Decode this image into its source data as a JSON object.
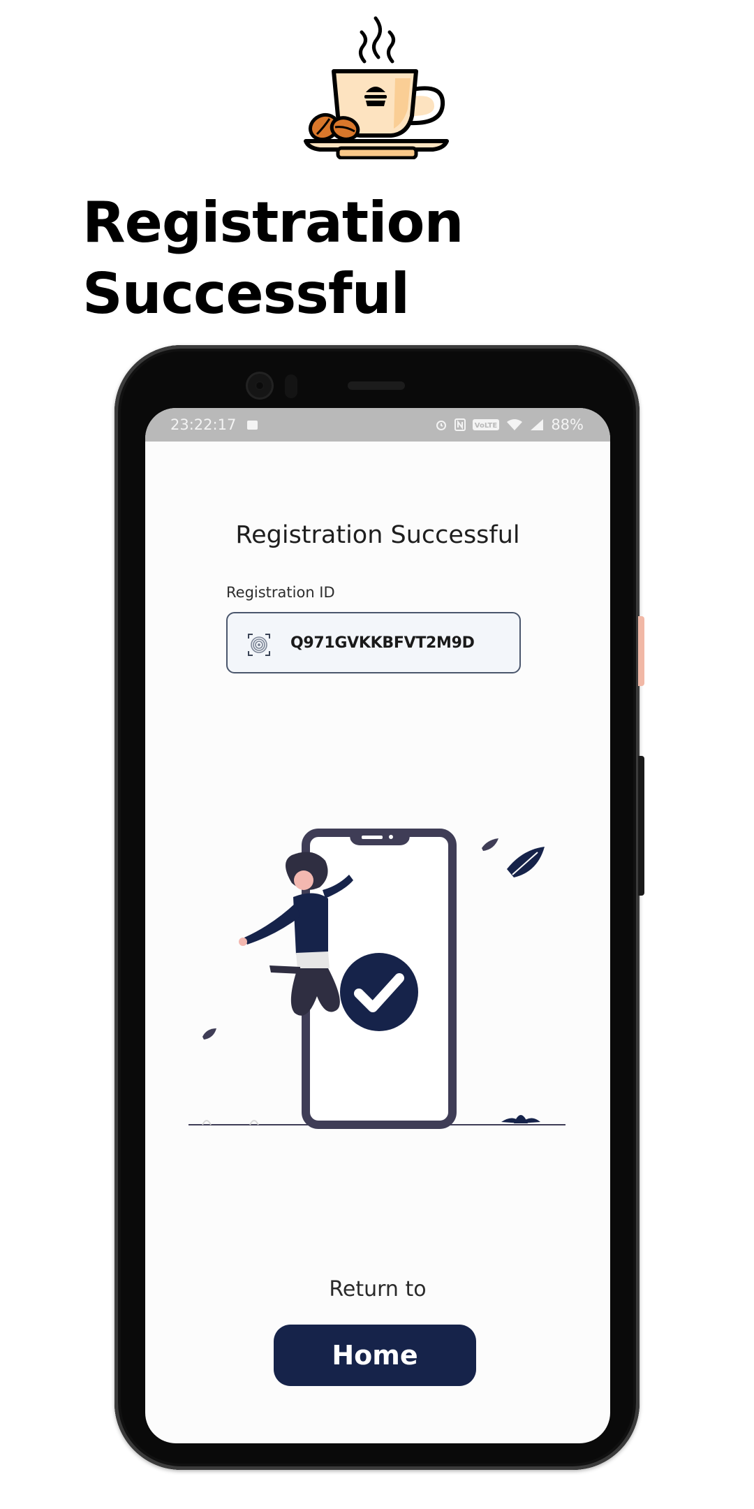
{
  "headline": {
    "line1": "Registration",
    "line2": "Successful"
  },
  "logo": {
    "icon": "coffee-cup-burger-icon",
    "colors": {
      "cup": "#fde3c0",
      "beans": "#d9772b",
      "outline": "#000000"
    }
  },
  "status_bar": {
    "time": "23:22:17",
    "battery": "88%",
    "icons": [
      "image-icon",
      "alarm-icon",
      "nfc-icon",
      "volte-icon",
      "wifi-icon",
      "signal-icon"
    ]
  },
  "screen": {
    "title": "Registration Successful",
    "registration_label": "Registration ID",
    "registration_id": "Q971GVKKBFVT2M9D",
    "return_text": "Return to",
    "home_button": "Home"
  },
  "colors": {
    "accent": "#16234a",
    "status_bar_bg": "#b9b9b9",
    "field_bg": "#f3f6fa",
    "field_border": "#4a566c"
  }
}
